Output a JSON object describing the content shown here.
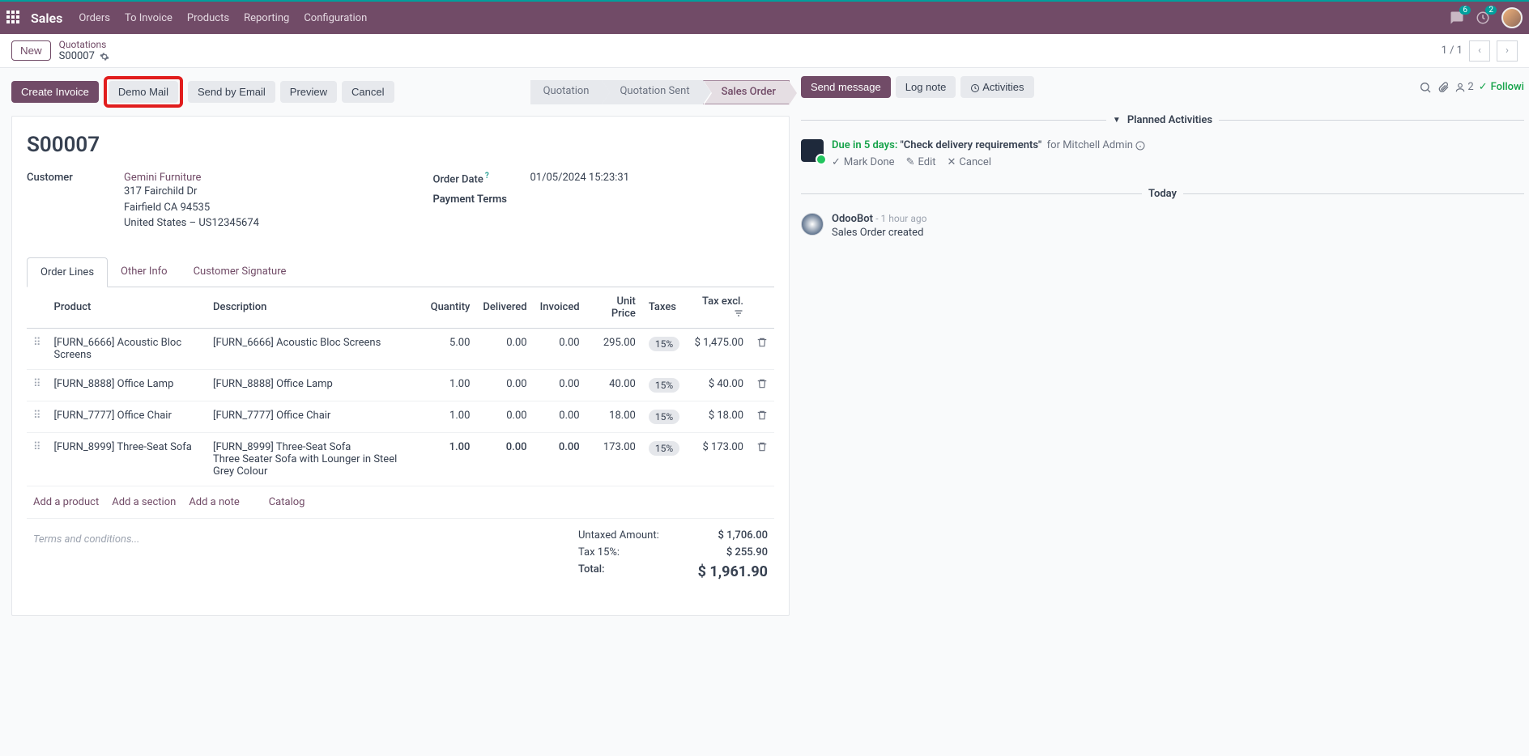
{
  "topnav": {
    "brand": "Sales",
    "items": [
      "Orders",
      "To Invoice",
      "Products",
      "Reporting",
      "Configuration"
    ],
    "msg_count": "6",
    "clock_count": "2"
  },
  "breadcrumb": {
    "new_btn": "New",
    "parent": "Quotations",
    "current": "S00007",
    "pager": "1 / 1"
  },
  "actions": {
    "create_invoice": "Create Invoice",
    "demo_mail": "Demo Mail",
    "send_email": "Send by Email",
    "preview": "Preview",
    "cancel": "Cancel"
  },
  "stages": {
    "quotation": "Quotation",
    "quotation_sent": "Quotation Sent",
    "sales_order": "Sales Order"
  },
  "record": {
    "title": "S00007",
    "customer_label": "Customer",
    "customer_name": "Gemini Furniture",
    "addr1": "317 Fairchild Dr",
    "addr2": "Fairfield CA 94535",
    "addr3": "United States – US12345674",
    "order_date_label": "Order Date",
    "order_date": "01/05/2024 15:23:31",
    "payment_terms_label": "Payment Terms"
  },
  "tabs": {
    "order_lines": "Order Lines",
    "other_info": "Other Info",
    "signature": "Customer Signature"
  },
  "cols": {
    "product": "Product",
    "description": "Description",
    "quantity": "Quantity",
    "delivered": "Delivered",
    "invoiced": "Invoiced",
    "unit_price": "Unit Price",
    "taxes": "Taxes",
    "tax_excl": "Tax excl."
  },
  "lines": [
    {
      "product": "[FURN_6666] Acoustic Bloc Screens",
      "desc": "[FURN_6666] Acoustic Bloc Screens",
      "qty": "5.00",
      "del": "0.00",
      "inv": "0.00",
      "price": "295.00",
      "tax": "15%",
      "sub": "$ 1,475.00",
      "editable": false
    },
    {
      "product": "[FURN_8888] Office Lamp",
      "desc": "[FURN_8888] Office Lamp",
      "qty": "1.00",
      "del": "0.00",
      "inv": "0.00",
      "price": "40.00",
      "tax": "15%",
      "sub": "$ 40.00",
      "editable": false
    },
    {
      "product": "[FURN_7777] Office Chair",
      "desc": "[FURN_7777] Office Chair",
      "qty": "1.00",
      "del": "0.00",
      "inv": "0.00",
      "price": "18.00",
      "tax": "15%",
      "sub": "$ 18.00",
      "editable": false
    },
    {
      "product": "[FURN_8999] Three-Seat Sofa",
      "desc": "[FURN_8999] Three-Seat Sofa\nThree Seater Sofa with Lounger in Steel Grey Colour",
      "qty": "1.00",
      "del": "0.00",
      "inv": "0.00",
      "price": "173.00",
      "tax": "15%",
      "sub": "$ 173.00",
      "editable": true
    }
  ],
  "add": {
    "product": "Add a product",
    "section": "Add a section",
    "note": "Add a note",
    "catalog": "Catalog"
  },
  "terms_placeholder": "Terms and conditions...",
  "totals": {
    "untaxed_label": "Untaxed Amount:",
    "untaxed": "$ 1,706.00",
    "tax_label": "Tax 15%:",
    "tax": "$ 255.90",
    "total_label": "Total:",
    "total": "$ 1,961.90"
  },
  "chatter": {
    "send": "Send message",
    "log": "Log note",
    "activities": "Activities",
    "followers": "2",
    "follow_label": "Followi"
  },
  "planned": {
    "header": "Planned Activities",
    "due": "Due in 5 days:",
    "title": "\"Check delivery requirements\"",
    "for": "for Mitchell Admin",
    "mark_done": "Mark Done",
    "edit": "Edit",
    "cancel": "Cancel"
  },
  "today": {
    "header": "Today",
    "author": "OdooBot",
    "time": "- 1 hour ago",
    "msg": "Sales Order created"
  }
}
